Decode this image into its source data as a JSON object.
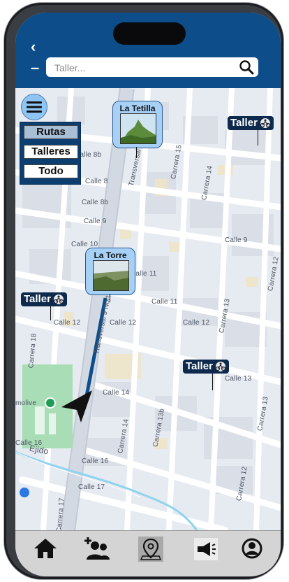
{
  "search": {
    "placeholder": "Taller..."
  },
  "filters": [
    {
      "label": "Rutas",
      "active": true
    },
    {
      "label": "Talleres",
      "active": false
    },
    {
      "label": "Todo",
      "active": false
    }
  ],
  "photo_pins": [
    {
      "label": "La Tetilla"
    },
    {
      "label": "La Torre"
    }
  ],
  "taller_pins": [
    {
      "label": "Taller"
    },
    {
      "label": "Taller"
    },
    {
      "label": "Taller"
    }
  ],
  "street_labels": [
    "Calle 8b",
    "Calle 8b",
    "Calle 8",
    "Calle 9",
    "Calle 9",
    "Calle 10",
    "Calle 11",
    "Calle 11",
    "Calle 12",
    "Calle 12",
    "Calle 12",
    "Calle 13",
    "Calle 14",
    "Calle 16",
    "Calle 17",
    "Calle 16",
    "Carrera 15",
    "Carrera 14",
    "Carrera 13",
    "Carrera 13",
    "Carrera 12",
    "Carrera 13b",
    "Carrera 14",
    "Carrera 12",
    "Carrera 18",
    "Carrera 17",
    "Transversal 9 Norte",
    "Transversal 9 Norte",
    "Ejido",
    "molive"
  ],
  "icons": {
    "back": "chevron-left-icon",
    "search": "magnifier-icon",
    "menu": "hamburger-icon",
    "navigation": "navigation-arrow-icon",
    "nav": [
      "home-icon",
      "add-user-icon",
      "map-pin-icon",
      "megaphone-icon",
      "profile-icon"
    ]
  },
  "colors": {
    "header": "#0c4d8a",
    "route": "#0c4d8a",
    "filter_panel": "#0c3e70",
    "taller_badge": "#0d2a4d",
    "photo_pin": "#a6d0f5",
    "navbar": "#d4d4d4"
  }
}
